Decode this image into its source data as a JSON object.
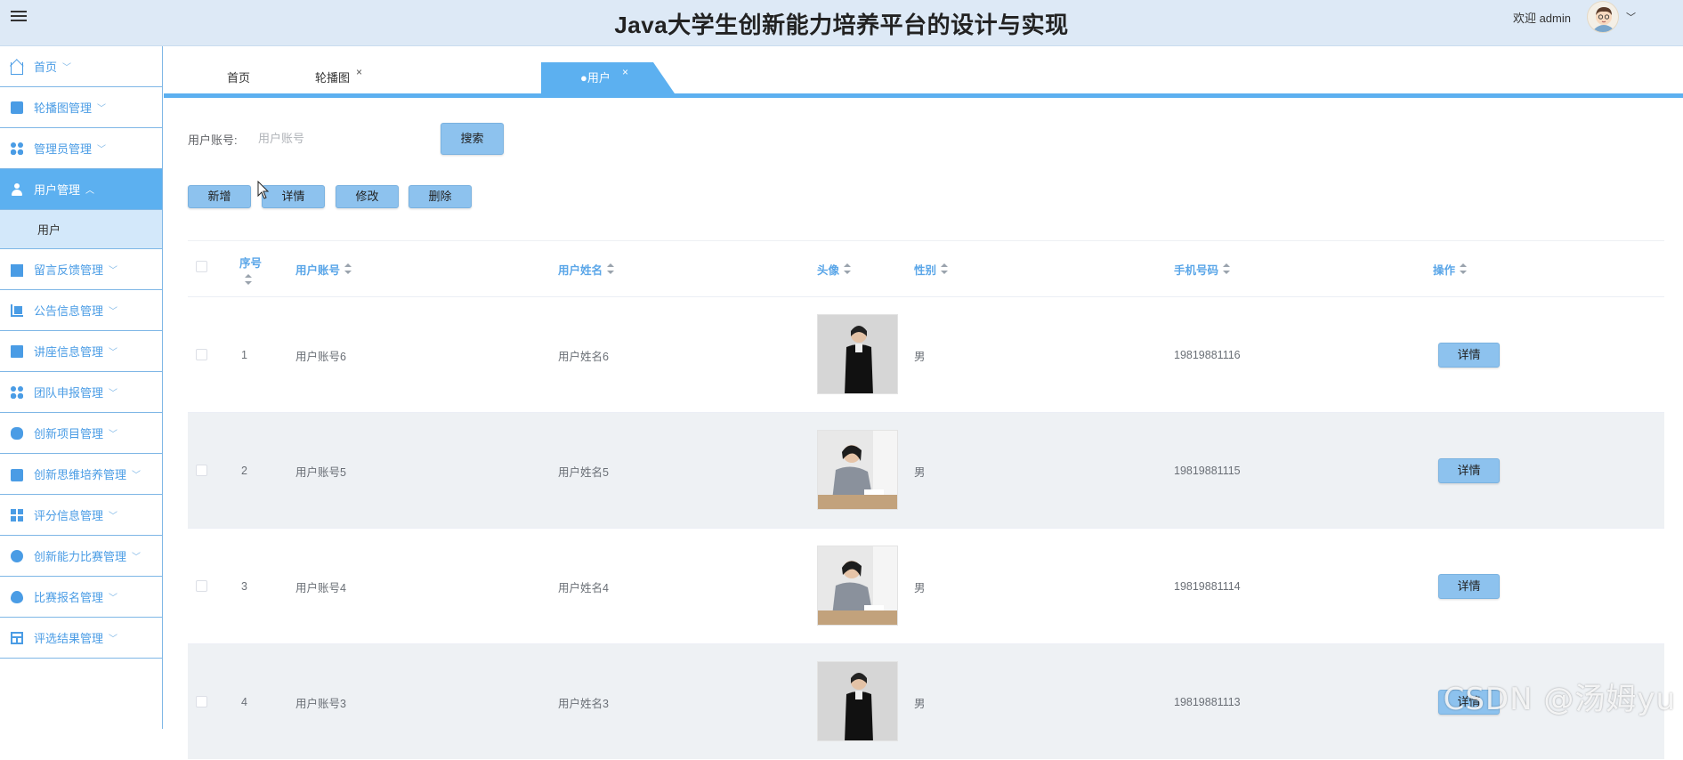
{
  "header": {
    "title": "Java大学生创新能力培养平台的设计与实现",
    "welcome": "欢迎 admin",
    "caret": "﹀"
  },
  "sidebar": {
    "items": [
      {
        "label": "首页",
        "icon": "home-icon"
      },
      {
        "label": "轮播图管理",
        "icon": "briefcase-icon"
      },
      {
        "label": "管理员管理",
        "icon": "grid-icon"
      },
      {
        "label": "用户管理",
        "icon": "user-icon",
        "active": true,
        "expanded": true
      },
      {
        "label": "留言反馈管理",
        "icon": "monitor-icon"
      },
      {
        "label": "公告信息管理",
        "icon": "crop-icon"
      },
      {
        "label": "讲座信息管理",
        "icon": "image-icon"
      },
      {
        "label": "团队申报管理",
        "icon": "grid-icon"
      },
      {
        "label": "创新项目管理",
        "icon": "mouse-icon"
      },
      {
        "label": "创新思维培养管理",
        "icon": "mail-icon"
      },
      {
        "label": "评分信息管理",
        "icon": "tiles-icon"
      },
      {
        "label": "创新能力比赛管理",
        "icon": "compass-icon"
      },
      {
        "label": "比赛报名管理",
        "icon": "drop-icon"
      },
      {
        "label": "评选结果管理",
        "icon": "layout-icon"
      }
    ],
    "subitem": "用户",
    "chevron_down": "﹀",
    "chevron_up": "︿"
  },
  "tabs": {
    "items": [
      {
        "label": "首页"
      },
      {
        "label": "轮播图",
        "close": "×"
      },
      {
        "label": "●用户",
        "close": "×",
        "active": true
      }
    ]
  },
  "search": {
    "label": "用户账号:",
    "placeholder": "用户账号",
    "button": "搜索"
  },
  "actions": {
    "add": "新增",
    "detail": "详情",
    "edit": "修改",
    "delete": "删除"
  },
  "table": {
    "columns": {
      "seq": "序号",
      "account": "用户账号",
      "name": "用户姓名",
      "avatar": "头像",
      "gender": "性别",
      "phone": "手机号码",
      "ops": "操作"
    },
    "rows": [
      {
        "seq": "1",
        "account": "用户账号6",
        "name": "用户姓名6",
        "gender": "男",
        "phone": "19819881116",
        "action": "详情"
      },
      {
        "seq": "2",
        "account": "用户账号5",
        "name": "用户姓名5",
        "gender": "男",
        "phone": "19819881115",
        "action": "详情"
      },
      {
        "seq": "3",
        "account": "用户账号4",
        "name": "用户姓名4",
        "gender": "男",
        "phone": "19819881114",
        "action": "详情"
      },
      {
        "seq": "4",
        "account": "用户账号3",
        "name": "用户姓名3",
        "gender": "男",
        "phone": "19819881113",
        "action": "详情"
      }
    ]
  },
  "watermark": "CSDN @汤姆yu",
  "colors": {
    "accent": "#5cb0f0",
    "header_bg": "#dde9f6",
    "button_bg": "#8dc2ee",
    "link_text": "#4a9ce5"
  }
}
